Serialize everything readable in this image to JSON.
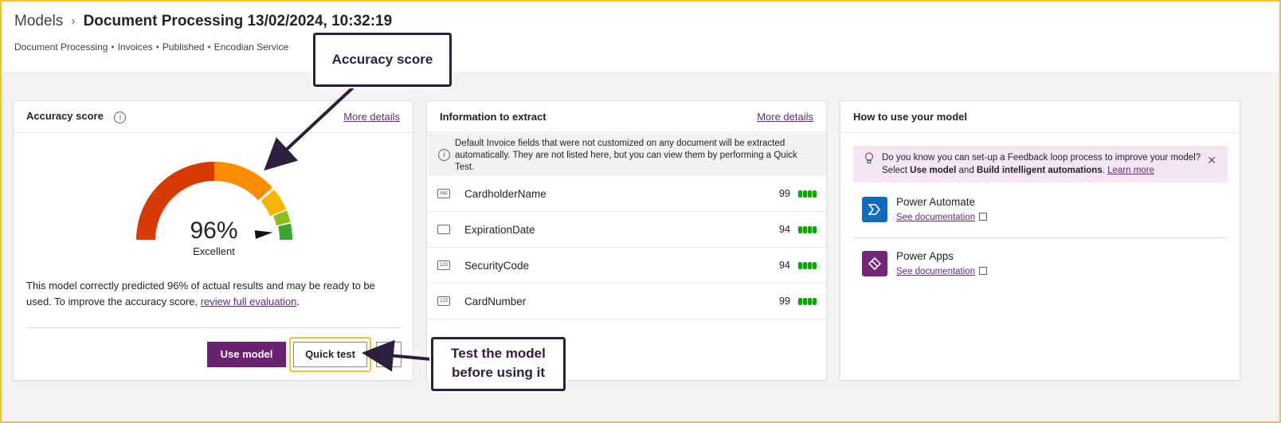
{
  "header": {
    "breadcrumb_root": "Models",
    "breadcrumb_sep": "›",
    "title": "Document Processing 13/02/2024, 10:32:19",
    "meta": [
      "Document Processing",
      "Invoices",
      "Published",
      "Encodian Service"
    ],
    "meta_sep": "•"
  },
  "accuracy_card": {
    "title": "Accuracy score",
    "info_icon": "i",
    "more_details": "More details",
    "score": 0.96,
    "score_text": "96%",
    "score_label": "Excellent",
    "description_before": "This model correctly predicted 96% of actual results and may be ready to be used. To improve the accuracy score, ",
    "description_link": "review full evaluation",
    "description_after": ".",
    "use_model_label": "Use model",
    "quick_test_label": "Quick test",
    "more_label": "⋮",
    "gauge_colors": [
      "#d83b01",
      "#ff8c00",
      "#f7b500",
      "#8cbd18",
      "#38a832"
    ]
  },
  "info_card": {
    "title": "Information to extract",
    "more_details": "More details",
    "info_icon": "i",
    "notice": "Default Invoice fields that were not customized on any document will be extracted automatically. They are not listed here, but you can view them by performing a Quick Test.",
    "fields": [
      {
        "icon": "Abc",
        "icon_name": "text-field-icon",
        "name": "CardholderName",
        "score": "99"
      },
      {
        "icon": "",
        "icon_name": "calendar-icon",
        "name": "ExpirationDate",
        "score": "94"
      },
      {
        "icon": "123",
        "icon_name": "number-field-icon",
        "name": "SecurityCode",
        "score": "94"
      },
      {
        "icon": "123",
        "icon_name": "number-field-icon",
        "name": "CardNumber",
        "score": "99"
      }
    ]
  },
  "howto_card": {
    "title": "How to use your model",
    "tip_part1": "Do you know you can set-up a Feedback loop process to improve your model? Select ",
    "tip_bold1": "Use model",
    "tip_part2": " and ",
    "tip_bold2": "Build intelligent automations",
    "tip_part3": ". ",
    "tip_link": "Learn more",
    "close": "✕",
    "apps": [
      {
        "name": "Power Automate",
        "doc": "See documentation"
      },
      {
        "name": "Power Apps",
        "doc": "See documentation"
      }
    ]
  },
  "annotations": {
    "accuracy_callout": "Accuracy score",
    "test_callout_line1": "Test the model",
    "test_callout_line2": "before using it",
    "frame_color": "#f2c230",
    "callout_color": "#2c1f3e"
  }
}
